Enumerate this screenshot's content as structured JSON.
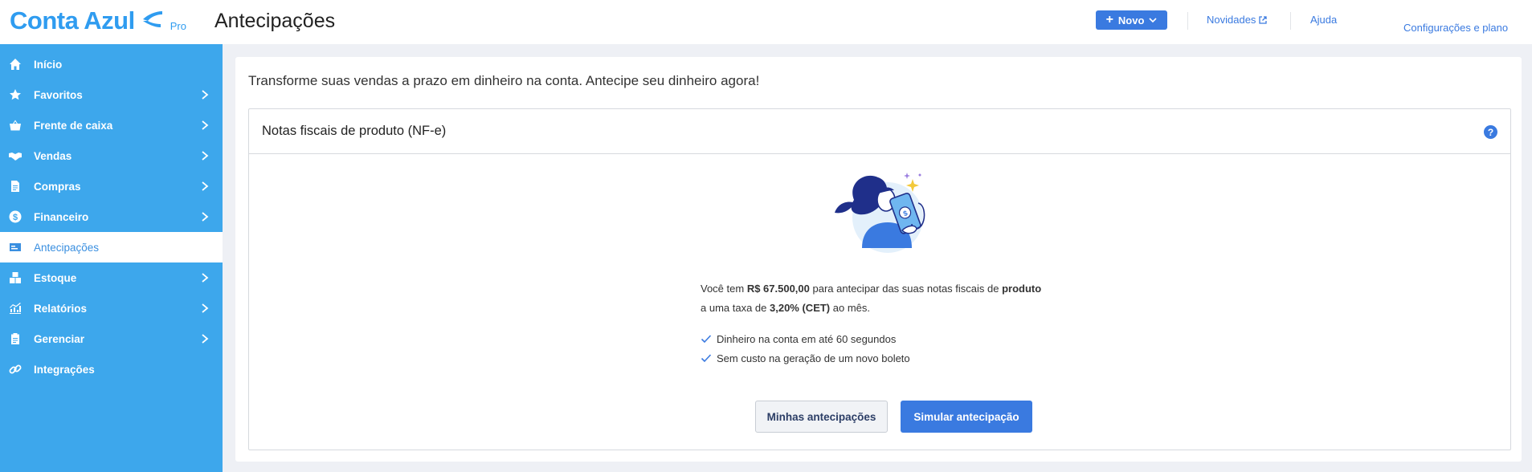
{
  "brand": {
    "name": "Conta Azul",
    "tier": "Pro",
    "color": "#2f9cf0"
  },
  "header": {
    "title": "Antecipações",
    "new_button": "Novo",
    "links": {
      "novidades": "Novidades",
      "ajuda": "Ajuda",
      "config": "Configurações e plano"
    }
  },
  "sidebar": {
    "items": [
      {
        "label": "Início",
        "icon": "home-icon",
        "has_submenu": false,
        "active": false
      },
      {
        "label": "Favoritos",
        "icon": "star-icon",
        "has_submenu": true,
        "active": false
      },
      {
        "label": "Frente de caixa",
        "icon": "basket-icon",
        "has_submenu": true,
        "active": false
      },
      {
        "label": "Vendas",
        "icon": "handshake-icon",
        "has_submenu": true,
        "active": false
      },
      {
        "label": "Compras",
        "icon": "document-icon",
        "has_submenu": true,
        "active": false
      },
      {
        "label": "Financeiro",
        "icon": "dollar-icon",
        "has_submenu": true,
        "active": false
      },
      {
        "label": "Antecipações",
        "icon": "card-icon",
        "has_submenu": false,
        "active": true
      },
      {
        "label": "Estoque",
        "icon": "boxes-icon",
        "has_submenu": true,
        "active": false
      },
      {
        "label": "Relatórios",
        "icon": "chart-icon",
        "has_submenu": true,
        "active": false
      },
      {
        "label": "Gerenciar",
        "icon": "clipboard-icon",
        "has_submenu": true,
        "active": false
      },
      {
        "label": "Integrações",
        "icon": "link-icon",
        "has_submenu": false,
        "active": false
      }
    ]
  },
  "main": {
    "heading": "Transforme suas vendas a prazo em dinheiro na conta. Antecipe seu dinheiro agora!",
    "panel": {
      "title": "Notas fiscais de produto (NF-e)",
      "help": "?",
      "desc": {
        "p1": "Você tem ",
        "amount": "R$ 67.500,00",
        "p2": " para antecipar das suas notas fiscais de ",
        "kind": "produto",
        "p3": "a uma taxa de ",
        "rate": "3,20% (CET)",
        "p4": " ao mês."
      },
      "benefits": [
        "Dinheiro na conta em até 60 segundos",
        "Sem custo na geração de um novo boleto"
      ],
      "buttons": {
        "secondary": "Minhas antecipações",
        "primary": "Simular antecipação"
      }
    }
  },
  "colors": {
    "accent": "#3a7ae0",
    "sidebar": "#3da7ec",
    "background": "#eef0f5"
  }
}
